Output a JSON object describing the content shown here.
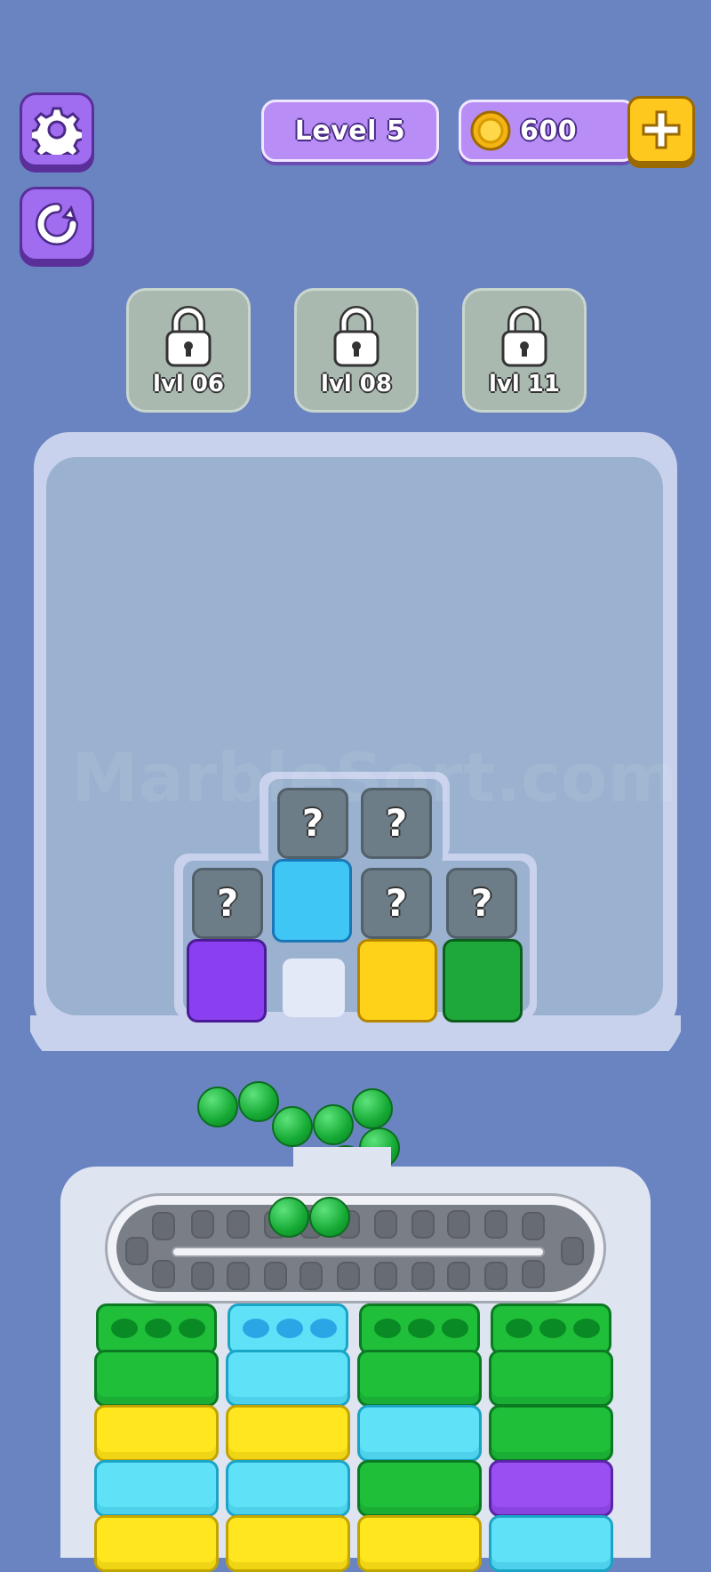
{
  "hud": {
    "settings_icon": "gear-icon",
    "restart_icon": "restart-icon",
    "level_label": "Level 5",
    "coins": "600",
    "coin_icon": "coin-icon",
    "add_icon": "plus-icon"
  },
  "locked_slots": [
    {
      "label": "lvl 06",
      "icon": "lock-icon"
    },
    {
      "label": "lvl 08",
      "icon": "lock-icon"
    },
    {
      "label": "lvl 11",
      "icon": "lock-icon"
    }
  ],
  "watermark": "MarbleSort.com",
  "mystery_symbol": "?",
  "crate_colors": {
    "cyan": "#3fb8f5",
    "purple": "#8a3ff0",
    "yellow": "#ffd21a",
    "green": "#1fa83a"
  },
  "columns": [
    [
      "green",
      "yellow",
      "cyan",
      "yellow"
    ],
    [
      "cyan",
      "yellow",
      "cyan",
      "yellow"
    ],
    [
      "green",
      "cyan",
      "green",
      "yellow"
    ],
    [
      "green",
      "green",
      "purple",
      "cyan"
    ]
  ]
}
